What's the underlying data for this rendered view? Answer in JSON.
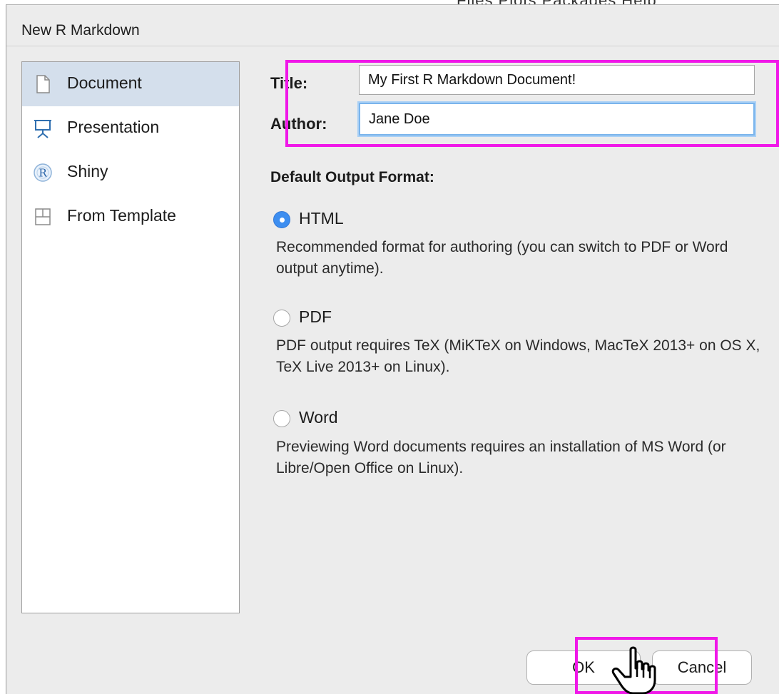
{
  "background_app": {
    "menu_fragment": "Files   Plots   Packages   Help"
  },
  "dialog": {
    "title": "New R Markdown"
  },
  "sidebar": {
    "items": [
      {
        "label": "Document",
        "icon": "document-icon",
        "selected": true
      },
      {
        "label": "Presentation",
        "icon": "presentation-icon",
        "selected": false
      },
      {
        "label": "Shiny",
        "icon": "shiny-r-icon",
        "selected": false
      },
      {
        "label": "From Template",
        "icon": "template-icon",
        "selected": false
      }
    ]
  },
  "form": {
    "title_label": "Title:",
    "title_value": "My First R Markdown Document!",
    "author_label": "Author:",
    "author_value": "Jane Doe"
  },
  "output": {
    "heading": "Default Output Format:",
    "options": [
      {
        "label": "HTML",
        "checked": true,
        "description": "Recommended format for authoring (you can switch to PDF or Word output anytime)."
      },
      {
        "label": "PDF",
        "checked": false,
        "description": "PDF output requires TeX (MiKTeX on Windows, MacTeX 2013+ on OS X, TeX Live 2013+ on Linux)."
      },
      {
        "label": "Word",
        "checked": false,
        "description": "Previewing Word documents requires an installation of MS Word (or Libre/Open Office on Linux)."
      }
    ]
  },
  "buttons": {
    "ok_label": "OK",
    "cancel_label": "Cancel"
  },
  "colors": {
    "highlight": "#f018e8",
    "radio_checked": "#3d8ef0",
    "selection": "#d4dfec",
    "focus_ring": "#7ab4ec"
  }
}
